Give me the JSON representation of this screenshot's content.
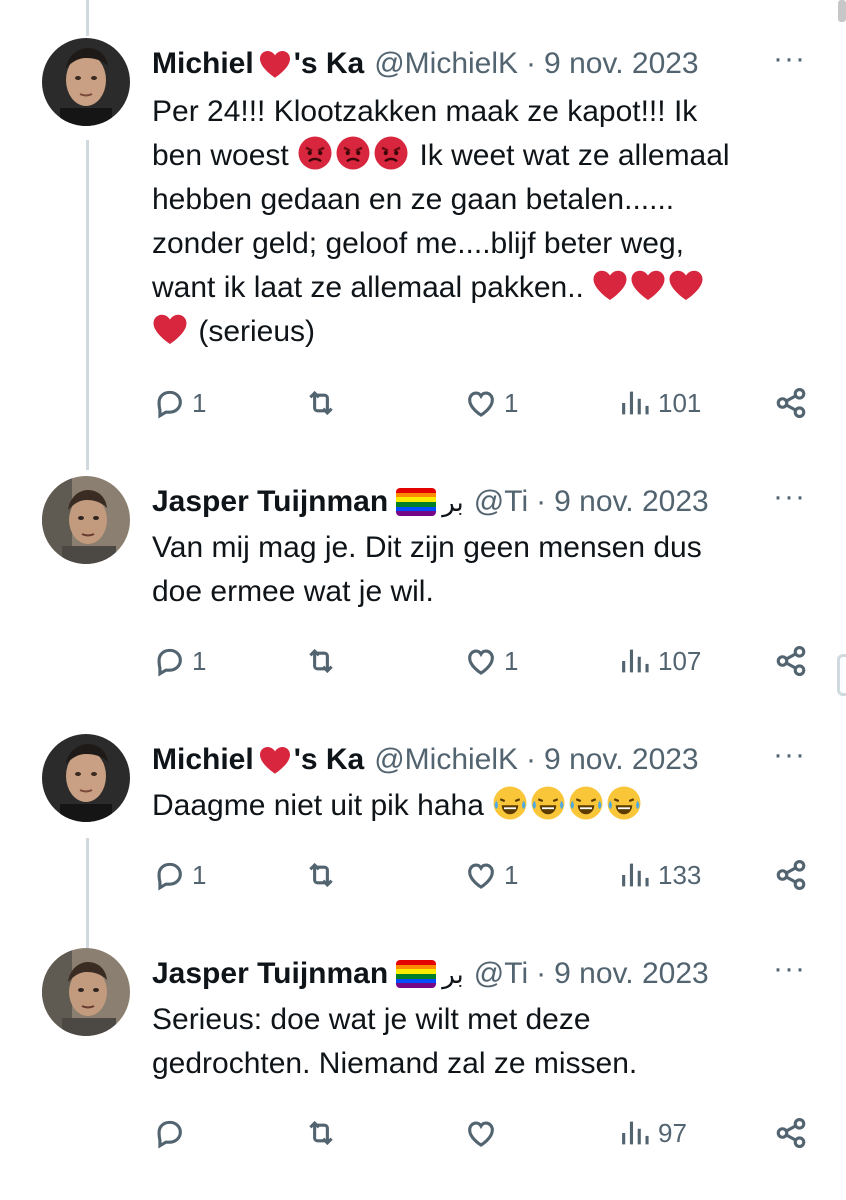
{
  "colors": {
    "text": "#0f1419",
    "muted": "#536471",
    "line": "#cfd9de",
    "heart": "#d7263d"
  },
  "tweets": [
    {
      "author": "Michiel",
      "author_tail": "'s Ka",
      "handle": "@MichielK",
      "separator": "·",
      "date": "9 nov. 2023",
      "more": "···",
      "body_line1": "Per 24!!! Klootzakken maak ze kapot!!! Ik",
      "body_line2a": "ben woest",
      "body_line2b": "Ik weet wat ze allemaal",
      "body_line3": "hebben gedaan en ze gaan betalen......",
      "body_line4": "zonder geld; geloof me....blijf beter weg,",
      "body_line5": "want ik laat ze allemaal pakken..",
      "body_line6": "(serieus)",
      "replies": "1",
      "likes": "1",
      "views": "101"
    },
    {
      "author": "Jasper Tuijnman",
      "arabic": "بر",
      "handle": "@Ti",
      "separator": "·",
      "date": "9 nov. 2023",
      "more": "···",
      "body_line1": "Van mij mag je. Dit zijn geen mensen dus",
      "body_line2": "doe ermee wat je wil.",
      "replies": "1",
      "likes": "1",
      "views": "107"
    },
    {
      "author": "Michiel",
      "author_tail": "'s Ka",
      "handle": "@MichielK",
      "separator": "·",
      "date": "9 nov. 2023",
      "more": "···",
      "body_line1": "Daagme niet uit pik haha",
      "replies": "1",
      "likes": "1",
      "views": "133"
    },
    {
      "author": "Jasper Tuijnman",
      "arabic": "بر",
      "handle": "@Ti",
      "separator": "·",
      "date": "9 nov. 2023",
      "more": "···",
      "body_line1": "Serieus: doe wat je wilt met deze",
      "body_line2": "gedrochten. Niemand zal ze missen.",
      "replies": "",
      "likes": "",
      "views": "97"
    }
  ]
}
